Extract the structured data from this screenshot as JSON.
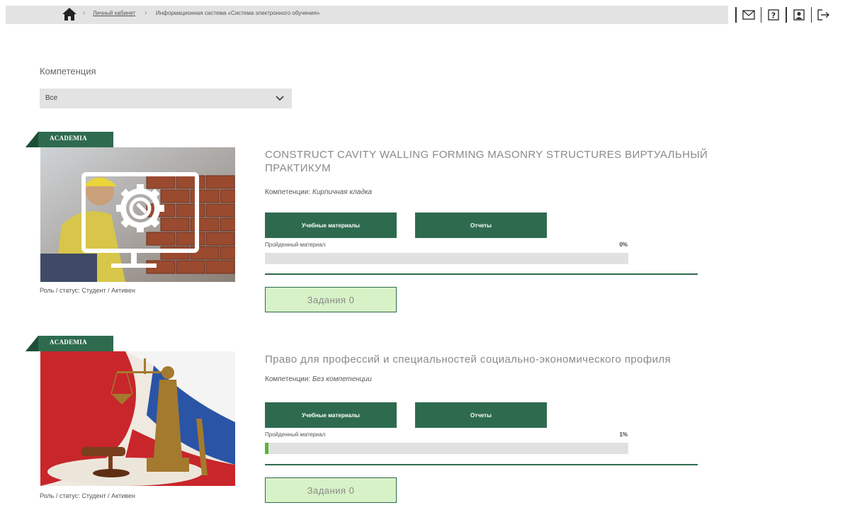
{
  "breadcrumb": {
    "items": [
      {
        "label": "Личный кабинет",
        "link": true
      },
      {
        "label": "Информационная система «Система электронного обучения»",
        "link": false
      }
    ]
  },
  "top_icons": [
    "mail-icon",
    "help-icon",
    "profile-icon",
    "logout-icon"
  ],
  "filter": {
    "label": "Компетенция",
    "selected": "Все"
  },
  "courses": [
    {
      "badge": "ACADEMIA",
      "title": "CONSTRUCT CAVITY WALLING FORMING MASONRY STRUCTURES ВИРТУАЛЬНЫЙ ПРАКТИКУМ",
      "competency_label": "Компетенции:",
      "competency_value": "Кирпичная кладка",
      "materials_button": "Учебные материалы",
      "reports_button": "Отчеты",
      "progress_label": "Пройденный материал",
      "progress_text": "0%",
      "progress": 0,
      "tasks_button": "Задания 0",
      "role_label": "Роль / статус:",
      "role_value": "Студент / Активен"
    },
    {
      "badge": "ACADEMIA",
      "title": "Право для профессий и специальностей социально-экономического профиля",
      "competency_label": "Компетенции:",
      "competency_value": "Без компетенции",
      "materials_button": "Учебные материалы",
      "reports_button": "Отчеты",
      "progress_label": "Пройденный материал",
      "progress_text": "1%",
      "progress": 0.01,
      "tasks_button": "Задания 0",
      "role_label": "Роль / статус:",
      "role_value": "Студент / Активен"
    }
  ],
  "colors": {
    "accent": "#2e6b4e",
    "progress_fill": "#5ab53a",
    "task_bg": "#d7f2c6",
    "bar_bg": "#e3e3e3"
  }
}
